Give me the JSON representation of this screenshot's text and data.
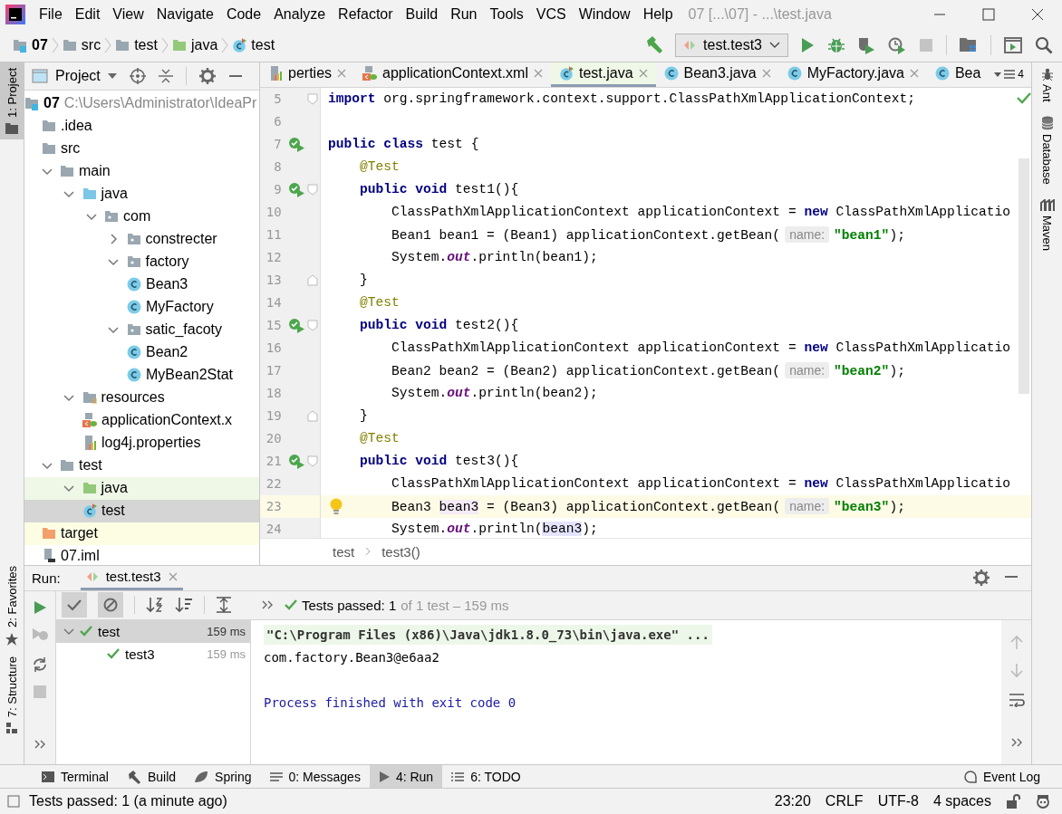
{
  "window": {
    "title": "07 [...\\07] - ...\\test.java",
    "menu": [
      "File",
      "Edit",
      "View",
      "Navigate",
      "Code",
      "Analyze",
      "Refactor",
      "Build",
      "Run",
      "Tools",
      "VCS",
      "Window",
      "Help"
    ]
  },
  "navigation_bar": {
    "breadcrumbs": [
      {
        "label": "07",
        "kind": "module"
      },
      {
        "label": "src",
        "kind": "folder"
      },
      {
        "label": "test",
        "kind": "folder"
      },
      {
        "label": "java",
        "kind": "test-root"
      },
      {
        "label": "test",
        "kind": "test-class"
      }
    ],
    "run_configuration": "test.test3"
  },
  "left_strip": {
    "top": [
      {
        "label": "1: Project",
        "kind": "project",
        "selected": true
      }
    ],
    "bottom": [
      {
        "label": "2: Favorites",
        "kind": "favorites",
        "selected": false
      },
      {
        "label": "7: Structure",
        "kind": "structure",
        "selected": false
      }
    ]
  },
  "project_panel": {
    "title": "Project",
    "tree": [
      {
        "label": "07",
        "kind": "module",
        "detail": "C:\\Users\\Administrator\\IdeaPr",
        "selected": false,
        "children": [
          {
            "label": ".idea",
            "kind": "folder",
            "selected": false
          },
          {
            "label": "src",
            "kind": "folder",
            "selected": false,
            "children": [
              {
                "label": "main",
                "kind": "folder",
                "expanded": true,
                "selected": false,
                "children": [
                  {
                    "label": "java",
                    "kind": "source-root",
                    "expanded": true,
                    "selected": false,
                    "children": [
                      {
                        "label": "com",
                        "kind": "package",
                        "expanded": true,
                        "selected": false,
                        "children": [
                          {
                            "label": "constrecter",
                            "kind": "package",
                            "expanded": false,
                            "selected": false
                          },
                          {
                            "label": "factory",
                            "kind": "package",
                            "expanded": true,
                            "selected": false,
                            "children": [
                              {
                                "label": "Bean3",
                                "kind": "class",
                                "selected": false
                              },
                              {
                                "label": "MyFactory",
                                "kind": "class",
                                "selected": false
                              }
                            ]
                          },
                          {
                            "label": "satic_facoty",
                            "kind": "package",
                            "expanded": true,
                            "selected": false,
                            "children": [
                              {
                                "label": "Bean2",
                                "kind": "class",
                                "selected": false
                              },
                              {
                                "label": "MyBean2Stat",
                                "kind": "class",
                                "selected": false
                              }
                            ]
                          }
                        ]
                      }
                    ]
                  },
                  {
                    "label": "resources",
                    "kind": "resources-root",
                    "expanded": true,
                    "selected": false,
                    "children": [
                      {
                        "label": "applicationContext.x",
                        "kind": "spring-xml",
                        "selected": false
                      },
                      {
                        "label": "log4j.properties",
                        "kind": "properties",
                        "selected": false
                      }
                    ]
                  }
                ]
              },
              {
                "label": "test",
                "kind": "folder",
                "expanded": true,
                "selected": false,
                "children": [
                  {
                    "label": "java",
                    "kind": "test-root",
                    "expanded": true,
                    "color": "#eff7e7",
                    "selected": false,
                    "children": [
                      {
                        "label": "test",
                        "kind": "test-class",
                        "selected": true
                      }
                    ]
                  }
                ]
              }
            ]
          },
          {
            "label": "target",
            "kind": "excluded-folder",
            "color": "#fdfde4",
            "selected": false
          },
          {
            "label": "07.iml",
            "kind": "iml",
            "selected": false
          }
        ]
      }
    ]
  },
  "editor": {
    "tabs": [
      {
        "label": "perties",
        "kind": "properties",
        "selected": false
      },
      {
        "label": "applicationContext.xml",
        "kind": "spring-xml",
        "selected": false
      },
      {
        "label": "test.java",
        "kind": "test-class",
        "selected": true
      },
      {
        "label": "Bean3.java",
        "kind": "class",
        "selected": false
      },
      {
        "label": "MyFactory.java",
        "kind": "class",
        "selected": false
      },
      {
        "label": "Bea",
        "kind": "class",
        "selected": false
      }
    ],
    "tab_count": "4",
    "lines": [
      {
        "number": "5",
        "fold_start": true,
        "tokens": [
          {
            "kind": "keyword",
            "text": "import"
          },
          {
            "kind": "plain",
            "text": " org.springframework.context.support.ClassPathXmlApplicationContext;"
          }
        ]
      },
      {
        "number": "6"
      },
      {
        "number": "7",
        "run_marker": true,
        "tokens": [
          {
            "kind": "keyword",
            "text": "public class"
          },
          {
            "kind": "plain",
            "text": " test {"
          }
        ],
        "children": [
          {
            "number": "8",
            "tokens": [
              {
                "kind": "annotation",
                "text": "@Test"
              }
            ]
          },
          {
            "number": "9",
            "run_marker": true,
            "fold_start": true,
            "tokens": [
              {
                "kind": "keyword",
                "text": "public void"
              },
              {
                "kind": "plain",
                "text": " test1(){"
              }
            ],
            "children": [
              {
                "number": "10",
                "tokens": [
                  {
                    "kind": "plain",
                    "text": "ClassPathXmlApplicationContext applicationContext = "
                  },
                  {
                    "kind": "keyword",
                    "text": "new"
                  },
                  {
                    "kind": "plain",
                    "text": " ClassPathXmlApplicatio"
                  }
                ]
              },
              {
                "number": "11",
                "tokens": [
                  {
                    "kind": "plain",
                    "text": "Bean1 bean1 = (Bean1) applicationContext.getBean("
                  },
                  {
                    "kind": "hint",
                    "text": "name:"
                  },
                  {
                    "kind": "string",
                    "text": "\"bean1\""
                  },
                  {
                    "kind": "plain",
                    "text": ");"
                  }
                ]
              },
              {
                "number": "12",
                "tokens": [
                  {
                    "kind": "plain",
                    "text": "System."
                  },
                  {
                    "kind": "static",
                    "text": "out"
                  },
                  {
                    "kind": "plain",
                    "text": ".println(bean1);"
                  }
                ]
              }
            ]
          },
          {
            "number": "13",
            "fold_end": true,
            "tokens": [
              {
                "kind": "plain",
                "text": "}"
              }
            ]
          },
          {
            "number": "14",
            "tokens": [
              {
                "kind": "annotation",
                "text": "@Test"
              }
            ]
          },
          {
            "number": "15",
            "run_marker": true,
            "fold_start": true,
            "tokens": [
              {
                "kind": "keyword",
                "text": "public void"
              },
              {
                "kind": "plain",
                "text": " test2(){"
              }
            ],
            "children": [
              {
                "number": "16",
                "tokens": [
                  {
                    "kind": "plain",
                    "text": "ClassPathXmlApplicationContext applicationContext = "
                  },
                  {
                    "kind": "keyword",
                    "text": "new"
                  },
                  {
                    "kind": "plain",
                    "text": " ClassPathXmlApplicatio"
                  }
                ]
              },
              {
                "number": "17",
                "tokens": [
                  {
                    "kind": "plain",
                    "text": "Bean2 bean2 = (Bean2) applicationContext.getBean("
                  },
                  {
                    "kind": "hint",
                    "text": "name:"
                  },
                  {
                    "kind": "string",
                    "text": "\"bean2\""
                  },
                  {
                    "kind": "plain",
                    "text": ");"
                  }
                ]
              },
              {
                "number": "18",
                "tokens": [
                  {
                    "kind": "plain",
                    "text": "System."
                  },
                  {
                    "kind": "static",
                    "text": "out"
                  },
                  {
                    "kind": "plain",
                    "text": ".println(bean2);"
                  }
                ]
              }
            ]
          },
          {
            "number": "19",
            "fold_end": true,
            "tokens": [
              {
                "kind": "plain",
                "text": "}"
              }
            ]
          },
          {
            "number": "20",
            "tokens": [
              {
                "kind": "annotation",
                "text": "@Test"
              }
            ]
          },
          {
            "number": "21",
            "run_marker": true,
            "fold_start": true,
            "tokens": [
              {
                "kind": "keyword",
                "text": "public void"
              },
              {
                "kind": "plain",
                "text": " test3(){"
              }
            ],
            "children": [
              {
                "number": "22",
                "tokens": [
                  {
                    "kind": "plain",
                    "text": "ClassPathXmlApplicationContext applicationContext = "
                  },
                  {
                    "kind": "keyword",
                    "text": "new"
                  },
                  {
                    "kind": "plain",
                    "text": " ClassPathXmlApplicatio"
                  }
                ]
              },
              {
                "number": "23",
                "current": true,
                "intention_bulb": true,
                "tokens": [
                  {
                    "kind": "plain",
                    "text": "Bean3 "
                  },
                  {
                    "kind": "declaration",
                    "text": "bean3"
                  },
                  {
                    "kind": "plain",
                    "text": " = (Bean3) applicationContext.getBean("
                  },
                  {
                    "kind": "hint",
                    "text": "name:"
                  },
                  {
                    "kind": "string",
                    "text": "\"bean3\""
                  },
                  {
                    "kind": "plain",
                    "text": ");"
                  }
                ]
              },
              {
                "number": "24",
                "tokens": [
                  {
                    "kind": "plain",
                    "text": "System."
                  },
                  {
                    "kind": "static",
                    "text": "out"
                  },
                  {
                    "kind": "plain",
                    "text": ".println("
                  },
                  {
                    "kind": "usage",
                    "text": "bean3"
                  },
                  {
                    "kind": "plain",
                    "text": ");"
                  }
                ]
              }
            ]
          }
        ]
      }
    ],
    "breadcrumbs": [
      "test",
      "test3()"
    ]
  },
  "right_strip": [
    {
      "label": "Ant",
      "kind": "ant"
    },
    {
      "label": "Database",
      "kind": "database"
    },
    {
      "label": "Maven",
      "kind": "maven"
    }
  ],
  "run_panel": {
    "title": "Run:",
    "tab": {
      "label": "test.test3",
      "selected": true
    },
    "toggles": [
      {
        "kind": "show-passed",
        "on": true
      },
      {
        "kind": "show-ignored",
        "on": true
      }
    ],
    "summary": {
      "status": "Tests passed: 1",
      "detail": "of 1 test – 159 ms"
    },
    "tests": [
      {
        "name": "test",
        "time": "159 ms",
        "passed": true,
        "selected": true,
        "expanded": true,
        "children": [
          {
            "name": "test3",
            "time": "159 ms",
            "passed": true,
            "selected": false
          }
        ]
      }
    ],
    "console": [
      {
        "kind": "command",
        "text": "\"C:\\Program Files (x86)\\Java\\jdk1.8.0_73\\bin\\java.exe\" ..."
      },
      {
        "kind": "output",
        "text": "com.factory.Bean3@e6aa2"
      },
      {
        "kind": "blank"
      },
      {
        "kind": "exit",
        "text": "Process finished with exit code 0"
      }
    ]
  },
  "tool_windows": [
    {
      "label": "Terminal",
      "kind": "terminal",
      "selected": false
    },
    {
      "label": "Build",
      "kind": "build",
      "selected": false
    },
    {
      "label": "Spring",
      "kind": "spring",
      "selected": false
    },
    {
      "label": "0: Messages",
      "kind": "messages",
      "selected": false
    },
    {
      "label": "4: Run",
      "kind": "run",
      "selected": true
    },
    {
      "label": "6: TODO",
      "kind": "todo",
      "selected": false
    }
  ],
  "event_log": "Event Log",
  "status_bar": {
    "message": "Tests passed: 1 (a minute ago)",
    "position": "23:20",
    "line_separator": "CRLF",
    "encoding": "UTF-8",
    "indent": "4 spaces"
  }
}
